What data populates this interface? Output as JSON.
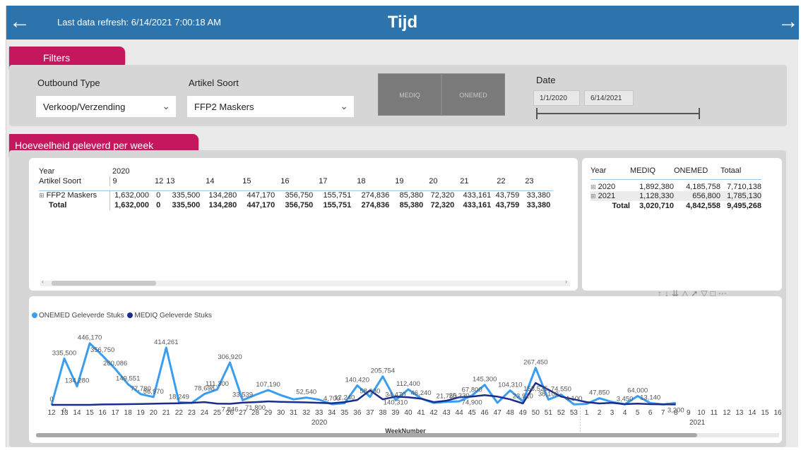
{
  "header": {
    "refresh_text": "Last data refresh: 6/14/2021 7:00:18 AM",
    "title": "Tijd",
    "back_icon": "arrow-left-icon",
    "forward_icon": "arrow-right-icon",
    "color": "#2d73ac"
  },
  "filters": {
    "section_label": "Filters",
    "outbound_type": {
      "label": "Outbound Type",
      "value": "Verkoop/Verzending"
    },
    "artikel_soort": {
      "label": "Artikel Soort",
      "value": "FFP2 Maskers"
    },
    "tiles": [
      "MEDIQ",
      "ONEMED"
    ],
    "date": {
      "label": "Date",
      "start": "1/1/2020",
      "end": "6/14/2021"
    }
  },
  "section2_label": "Hoeveelheid geleverd per week",
  "matrix": {
    "year_label": "Year",
    "year_value": "2020",
    "row_header": "Artikel Soort",
    "weeks": [
      "9",
      "12",
      "13",
      "14",
      "15",
      "16",
      "17",
      "18",
      "19",
      "20",
      "21",
      "22",
      "23"
    ],
    "rows": [
      {
        "label": "FFP2 Maskers",
        "values": [
          "1,632,000",
          "0",
          "335,500",
          "134,280",
          "447,170",
          "356,750",
          "155,751",
          "274,836",
          "85,380",
          "72,320",
          "433,161",
          "43,759",
          "33,380"
        ]
      },
      {
        "label": "Total",
        "values": [
          "1,632,000",
          "0",
          "335,500",
          "134,280",
          "447,170",
          "356,750",
          "155,751",
          "274,836",
          "85,380",
          "72,320",
          "433,161",
          "43,759",
          "33,380"
        ]
      }
    ]
  },
  "summary": {
    "headers": [
      "Year",
      "MEDIQ",
      "ONEMED",
      "Totaal"
    ],
    "rows": [
      {
        "year": "2020",
        "mediq": "1,892,380",
        "onemed": "4,185,758",
        "totaal": "7,710,138"
      },
      {
        "year": "2021",
        "mediq": "1,128,330",
        "onemed": "656,800",
        "totaal": "1,785,130"
      }
    ],
    "total": {
      "label": "Total",
      "mediq": "3,020,710",
      "onemed": "4,842,558",
      "totaal": "9,495,268"
    }
  },
  "chart_data": {
    "type": "line",
    "xlabel": "WeekNumber",
    "year_labels": [
      "2020",
      "2021"
    ],
    "categories": [
      "12",
      "13",
      "14",
      "15",
      "16",
      "17",
      "18",
      "19",
      "20",
      "21",
      "22",
      "23",
      "24",
      "25",
      "26",
      "27",
      "28",
      "29",
      "30",
      "31",
      "32",
      "33",
      "34",
      "35",
      "36",
      "37",
      "38",
      "39",
      "40",
      "41",
      "42",
      "43",
      "44",
      "45",
      "46",
      "47",
      "48",
      "49",
      "50",
      "51",
      "52",
      "53",
      "1",
      "2",
      "3",
      "4",
      "5",
      "6",
      "7",
      "8",
      "9",
      "10",
      "11",
      "12",
      "13",
      "14",
      "15",
      "16"
    ],
    "series": [
      {
        "name": "ONEMED Geleverde Stuks",
        "color": "#3a9df0",
        "values": [
          0,
          335500,
          134280,
          446170,
          356750,
          260086,
          149551,
          77780,
          56970,
          414261,
          18249,
          15000,
          78698,
          111300,
          306920,
          33539,
          71800,
          107190,
          70000,
          40000,
          52540,
          38000,
          4700,
          12240,
          140420,
          58030,
          205754,
          34470,
          112400,
          46240,
          14000,
          21750,
          25330,
          67800,
          145300,
          15000,
          104310,
          23910,
          267450,
          38100,
          74550,
          4100,
          7000,
          47850,
          21200,
          3450,
          64000,
          13140,
          3200,
          13140
        ],
        "note_values_len": 0
      },
      {
        "name": "MEDIQ Geleverde Stuks",
        "color": "#1a2d8c",
        "values": [
          0,
          0,
          0,
          0,
          3000,
          4000,
          5000,
          6000,
          8000,
          10000,
          12000,
          15000,
          20000,
          9000,
          7846,
          16000,
          20000,
          25000,
          22000,
          20000,
          18000,
          15000,
          12000,
          20000,
          35000,
          105000,
          40000,
          60000,
          55000,
          45000,
          20000,
          30000,
          55000,
          60000,
          70000,
          60000,
          40000,
          10000,
          158525,
          110000,
          60000,
          40000,
          20000,
          10000,
          15000,
          5000,
          9000,
          5000,
          4000,
          3200
        ]
      }
    ],
    "data_labels_onemed": [
      "0",
      "335,500",
      "134,280",
      "446,170",
      "356,750",
      "260,086",
      "149,551",
      "77,780",
      "56,970",
      "414,261",
      "18,249",
      "78,698",
      "111,300",
      "306,920",
      "33,539",
      "107,190",
      "52,540",
      "4,700",
      "12,240",
      "140,420",
      "58,030",
      "205,754",
      "34,470",
      "112,400",
      "46,240",
      "21,750",
      "25,330",
      "67,800",
      "145,300",
      "104,310",
      "23,910",
      "267,450",
      "38,100",
      "74,550",
      "4,100",
      "47,850",
      "3,450",
      "64,000",
      "13,140"
    ],
    "data_labels_mediq": [
      "0",
      "7,846",
      "71,800",
      "140,310",
      "74,900",
      "158,525",
      "3,200"
    ],
    "ylim": [
      0,
      470000
    ]
  },
  "legend": [
    {
      "label": "ONEMED Geleverde Stuks",
      "color": "#3a9df0"
    },
    {
      "label": "MEDIQ Geleverde Stuks",
      "color": "#1a2d8c"
    }
  ],
  "accent_pink": "#c5175e",
  "toolbar_icons": [
    "sort-asc-icon",
    "sort-desc-icon",
    "expand-all-icon",
    "drill-icon",
    "pin-icon",
    "filter-icon",
    "focus-icon",
    "more-icon"
  ]
}
